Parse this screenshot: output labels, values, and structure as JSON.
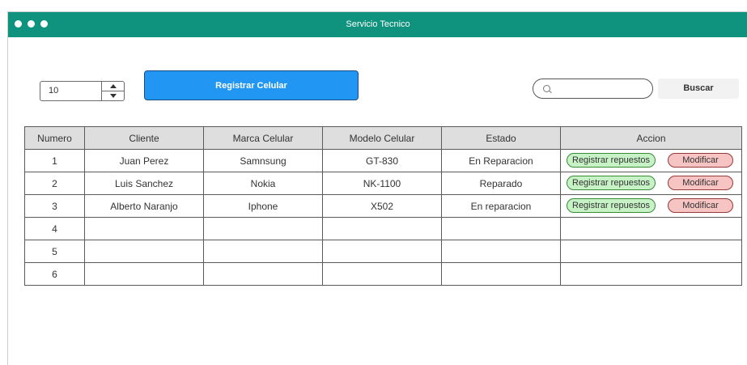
{
  "window": {
    "title": "Servicio Tecnico"
  },
  "toolbar": {
    "stepper_value": "10",
    "register_label": "Registrar Celular",
    "search_placeholder": "",
    "search_value": "",
    "search_label": "Buscar"
  },
  "table": {
    "headers": [
      "Numero",
      "Cliente",
      "Marca Celular",
      "Modelo Celular",
      "Estado",
      "Accion"
    ],
    "rows": [
      {
        "numero": "1",
        "cliente": "Juan Perez",
        "marca": "Samnsung",
        "modelo": "GT-830",
        "estado": "En Reparacion",
        "repuestos": "Registrar repuestos",
        "modificar": "Modificar"
      },
      {
        "numero": "2",
        "cliente": "Luis Sanchez",
        "marca": "Nokia",
        "modelo": "NK-1100",
        "estado": "Reparado",
        "repuestos": "Registrar repuestos",
        "modificar": "Modificar"
      },
      {
        "numero": "3",
        "cliente": "Alberto Naranjo",
        "marca": "Iphone",
        "modelo": "X502",
        "estado": "En reparacion",
        "repuestos": "Registrar repuestos",
        "modificar": "Modificar"
      },
      {
        "numero": "4",
        "cliente": "",
        "marca": "",
        "modelo": "",
        "estado": ""
      },
      {
        "numero": "5",
        "cliente": "",
        "marca": "",
        "modelo": "",
        "estado": ""
      },
      {
        "numero": "6",
        "cliente": "",
        "marca": "",
        "modelo": "",
        "estado": ""
      }
    ]
  },
  "colors": {
    "titlebar": "#10937e",
    "primary_button": "#2196f3",
    "repuestos_pill": "#c7f2c5",
    "modificar_pill": "#f7c4c4",
    "header_bg": "#dedede"
  },
  "icons": [
    "window-dot-icon",
    "chevron-up-icon",
    "chevron-down-icon",
    "search-icon"
  ]
}
